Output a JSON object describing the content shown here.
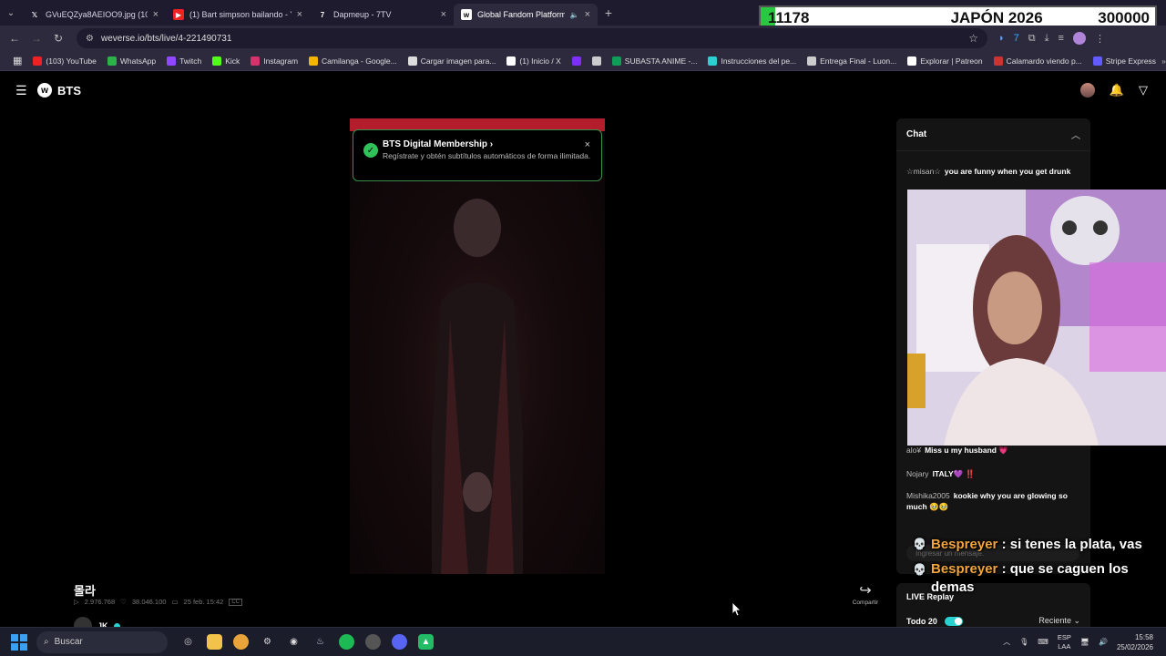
{
  "browser": {
    "tabs": [
      {
        "title": "GVuEQZya8AEIOO9.jpg (1079×",
        "favicon": "X",
        "active": false
      },
      {
        "title": "(1) Bart simpson bailando - You",
        "favicon": "YT",
        "active": false
      },
      {
        "title": "Dapmeup - 7TV",
        "favicon": "7",
        "active": false
      },
      {
        "title": "Global Fandom Platform - W",
        "favicon": "W",
        "active": true
      }
    ],
    "url": "weverse.io/bts/live/4-221490731",
    "bookmarks": [
      {
        "label": "(103) YouTube",
        "color": "#e22"
      },
      {
        "label": "WhatsApp",
        "color": "#2bb34a"
      },
      {
        "label": "Twitch",
        "color": "#9146ff"
      },
      {
        "label": "Kick",
        "color": "#53fc18"
      },
      {
        "label": "Instagram",
        "color": "#d6336c"
      },
      {
        "label": "Camilanga - Google...",
        "color": "#f4b400"
      },
      {
        "label": "Cargar imagen para...",
        "color": "#ddd"
      },
      {
        "label": "(1) Inicio / X",
        "color": "#fff"
      },
      {
        "label": "",
        "color": "#7b2ff7"
      },
      {
        "label": "",
        "color": "#ccc"
      },
      {
        "label": "SUBASTA ANIME -...",
        "color": "#0f9d58"
      },
      {
        "label": "Instrucciones del pe...",
        "color": "#2ad1d1"
      },
      {
        "label": "Entrega Final - Luon...",
        "color": "#ccc"
      },
      {
        "label": "Explorar | Patreon",
        "color": "#fff"
      },
      {
        "label": "Calamardo viendo p...",
        "color": "#c33"
      },
      {
        "label": "Stripe Express",
        "color": "#635bff"
      }
    ]
  },
  "overlay_goal": {
    "left": "11178",
    "center": "JAPÓN 2026",
    "right": "300000",
    "progress": 0.037
  },
  "site": {
    "brand": "BTS"
  },
  "membership_popup": {
    "title": "BTS Digital Membership",
    "chevron": "›",
    "subtitle": "Regístrate y obtén subtítulos automáticos de forma ilimitada."
  },
  "post": {
    "title": "몰라",
    "views": "2.976.768",
    "likes": "38.046.100",
    "date": "25 feb. 15:42",
    "cc": "CC",
    "author": "JK",
    "share_label": "Compartir"
  },
  "chat": {
    "title": "Chat",
    "messages": [
      {
        "user": "☆misan☆",
        "text": "you are funny when you get drunk"
      },
      {
        "user": "alo¥",
        "text": "Miss u my husband 💗"
      },
      {
        "user": "Nojary",
        "text": "ITALY💜 ‼️"
      },
      {
        "user": "Mishika2005",
        "text": "kookie why you are glowing so much 🥹🥹"
      }
    ],
    "input_placeholder": "Ingresar un mensaje."
  },
  "replay": {
    "title": "LIVE Replay",
    "filter": "Todo 20",
    "sort": "Reciente"
  },
  "stream_chat_overlay": [
    {
      "user": "Bespreyer",
      "text": ": si tenes la plata, vas"
    },
    {
      "user": "Bespreyer",
      "text": ": que se caguen los demas"
    }
  ],
  "taskbar": {
    "search_placeholder": "Buscar",
    "lang_top": "ESP",
    "lang_bottom": "LAA",
    "time": "15:58",
    "date": "25/02/2026"
  }
}
